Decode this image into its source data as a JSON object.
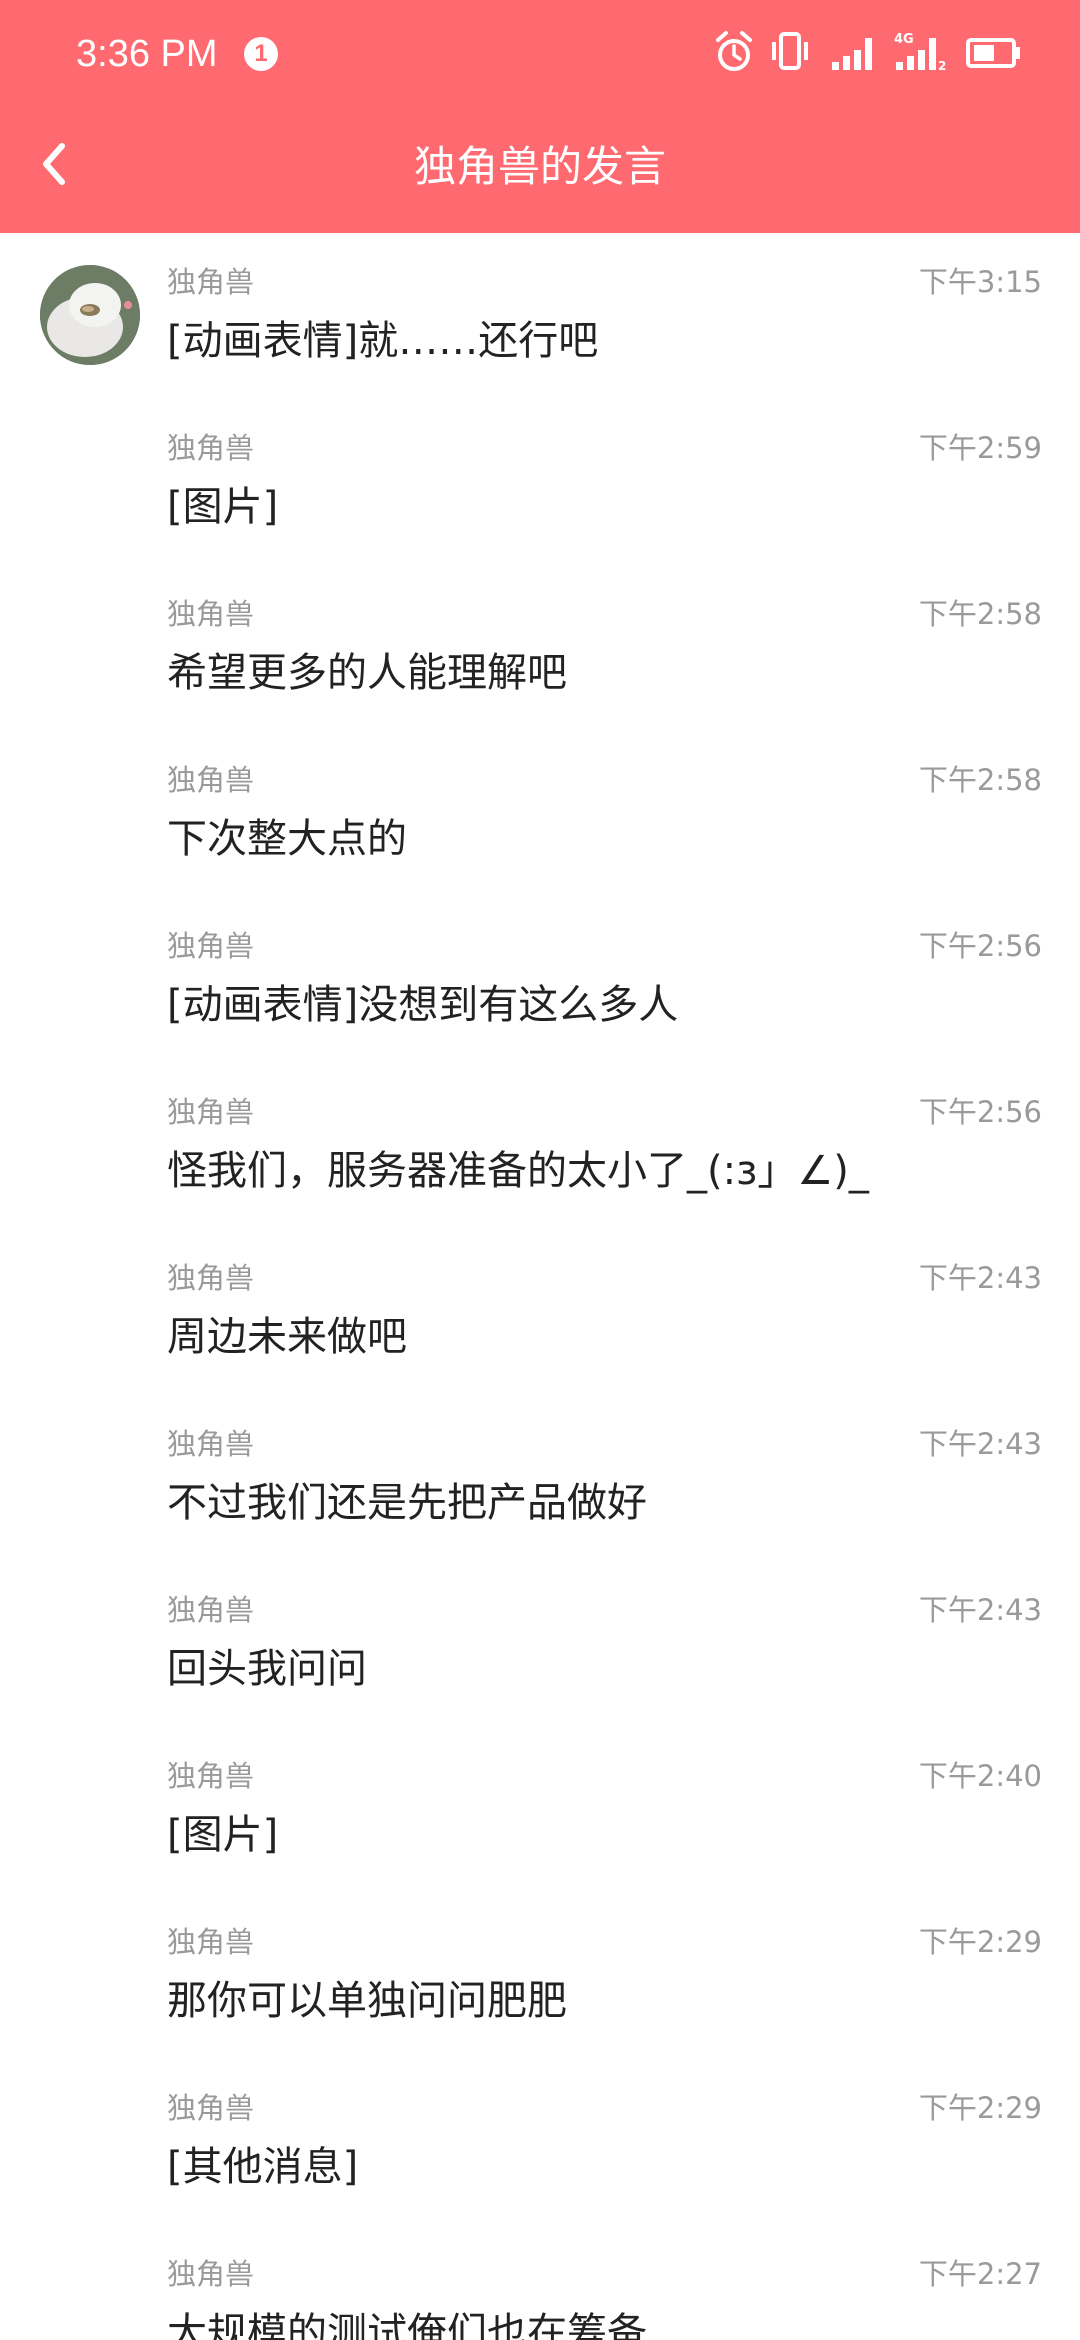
{
  "status_bar": {
    "time": "3:36 PM",
    "notification_count": "1",
    "icons": [
      "alarm-icon",
      "vibrate-icon",
      "signal-icon",
      "signal-4g-icon",
      "battery-icon"
    ],
    "network_label": "4G"
  },
  "header": {
    "title": "独角兽的发言",
    "back_icon": "chevron-left-icon",
    "background": "#ff6970"
  },
  "messages": [
    {
      "sender": "独角兽",
      "time": "下午3:15",
      "text": "[动画表情]就……还行吧",
      "show_avatar": true
    },
    {
      "sender": "独角兽",
      "time": "下午2:59",
      "text": "[图片]"
    },
    {
      "sender": "独角兽",
      "time": "下午2:58",
      "text": "希望更多的人能理解吧"
    },
    {
      "sender": "独角兽",
      "time": "下午2:58",
      "text": "下次整大点的"
    },
    {
      "sender": "独角兽",
      "time": "下午2:56",
      "text": "[动画表情]没想到有这么多人"
    },
    {
      "sender": "独角兽",
      "time": "下午2:56",
      "text": "怪我们，服务器准备的太小了_(:з」∠)_"
    },
    {
      "sender": "独角兽",
      "time": "下午2:43",
      "text": "周边未来做吧"
    },
    {
      "sender": "独角兽",
      "time": "下午2:43",
      "text": "不过我们还是先把产品做好"
    },
    {
      "sender": "独角兽",
      "time": "下午2:43",
      "text": "回头我问问"
    },
    {
      "sender": "独角兽",
      "time": "下午2:40",
      "text": "[图片]"
    },
    {
      "sender": "独角兽",
      "time": "下午2:29",
      "text": "那你可以单独问问肥肥"
    },
    {
      "sender": "独角兽",
      "time": "下午2:29",
      "text": "[其他消息]"
    },
    {
      "sender": "独角兽",
      "time": "下午2:27",
      "text": "大规模的测试俺们也在筹备"
    }
  ]
}
